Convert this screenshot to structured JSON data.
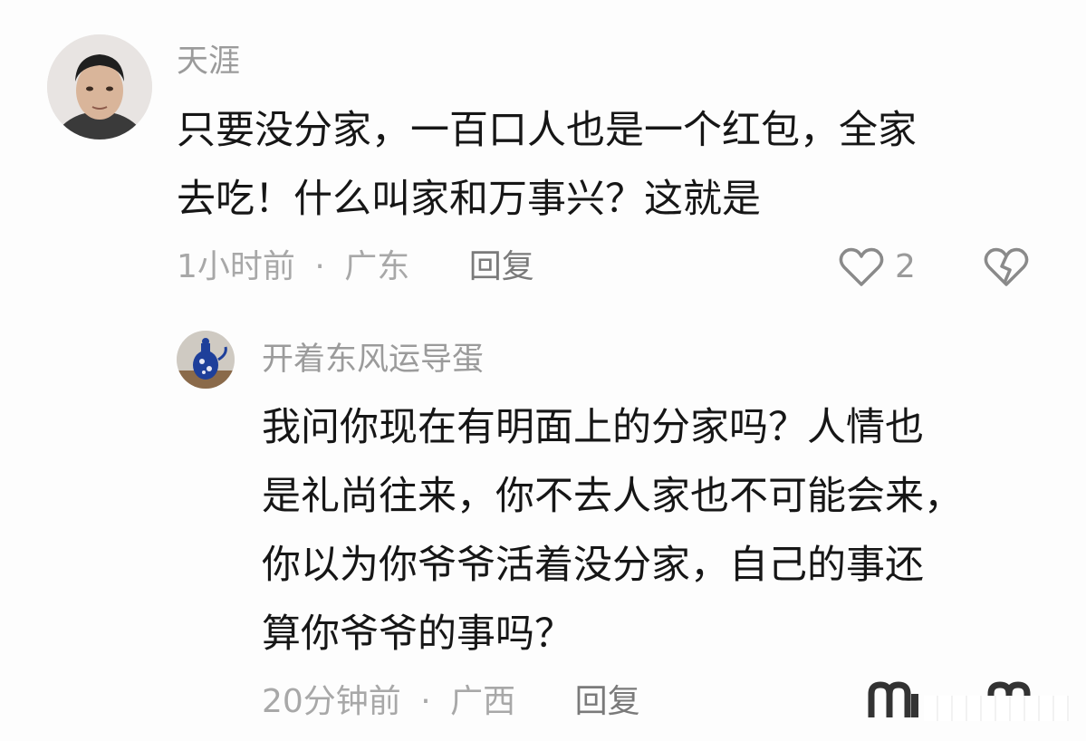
{
  "comments": [
    {
      "username": "天涯",
      "lines": [
        "只要没分家，一百口人也是一个红包，全家",
        "去吃！什么叫家和万事兴？这就是"
      ],
      "time": "1小时前",
      "separator": "·",
      "location": "广东",
      "reply_label": "回复",
      "like_count": "2",
      "icons": {
        "like": "heart-outline-icon",
        "dislike": "broken-heart-icon"
      }
    },
    {
      "username": "开着东风运导蛋",
      "lines": [
        "我问你现在有明面上的分家吗？人情也",
        "是礼尚往来，你不去人家也不可能会来，",
        "你以为你爷爷活着没分家，自己的事还",
        "算你爷爷的事吗？"
      ],
      "time": "20分钟前",
      "separator": "·",
      "location": "广西",
      "reply_label": "回复",
      "icons": {
        "like": "heart-outline-icon",
        "dislike": "broken-heart-icon"
      }
    }
  ],
  "colors": {
    "background": "#fdfdfd",
    "text": "#161616",
    "muted": "#9b9b9b"
  }
}
